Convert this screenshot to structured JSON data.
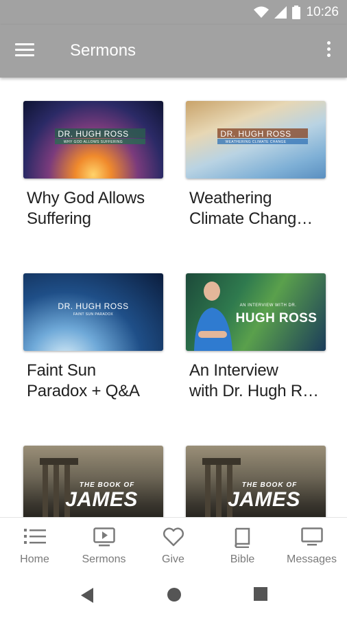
{
  "status_bar": {
    "time": "10:26",
    "icons": [
      "wifi-icon",
      "signal-icon",
      "battery-icon"
    ]
  },
  "app_bar": {
    "title": "Sermons",
    "menu_icon": "hamburger-icon",
    "overflow_icon": "more-vert-icon"
  },
  "sermons": [
    {
      "title": "Why God Allows\nSuffering",
      "thumb_speaker": "DR. HUGH ROSS",
      "thumb_subtitle": "WHY GOD ALLOWS SUFFERING"
    },
    {
      "title": "Weathering\nClimate Chang…",
      "thumb_speaker": "DR. HUGH ROSS",
      "thumb_subtitle": "WEATHERING CLIMATE CHANGE"
    },
    {
      "title": "Faint Sun\nParadox + Q&A",
      "thumb_speaker": "DR. HUGH ROSS",
      "thumb_subtitle": "FAINT SUN PARADOX"
    },
    {
      "title": "An Interview\nwith Dr. Hugh R…",
      "thumb_pre": "AN INTERVIEW WITH DR.",
      "thumb_speaker": "HUGH ROSS"
    },
    {
      "title": "",
      "thumb_pre": "THE BOOK OF",
      "thumb_speaker": "JAMES"
    },
    {
      "title": "",
      "thumb_pre": "THE BOOK OF",
      "thumb_speaker": "JAMES"
    }
  ],
  "bottom_nav": [
    {
      "label": "Home",
      "icon": "list-icon"
    },
    {
      "label": "Sermons",
      "icon": "play-screen-icon"
    },
    {
      "label": "Give",
      "icon": "heart-icon"
    },
    {
      "label": "Bible",
      "icon": "book-icon"
    },
    {
      "label": "Messages",
      "icon": "monitor-icon"
    }
  ],
  "system_nav": {
    "back_icon": "back-triangle-icon",
    "home_icon": "home-circle-icon",
    "recents_icon": "recents-square-icon"
  },
  "colors": {
    "app_bar": "#a2a2a2",
    "title_text": "#212121",
    "nav_text": "#7a7a7a"
  }
}
